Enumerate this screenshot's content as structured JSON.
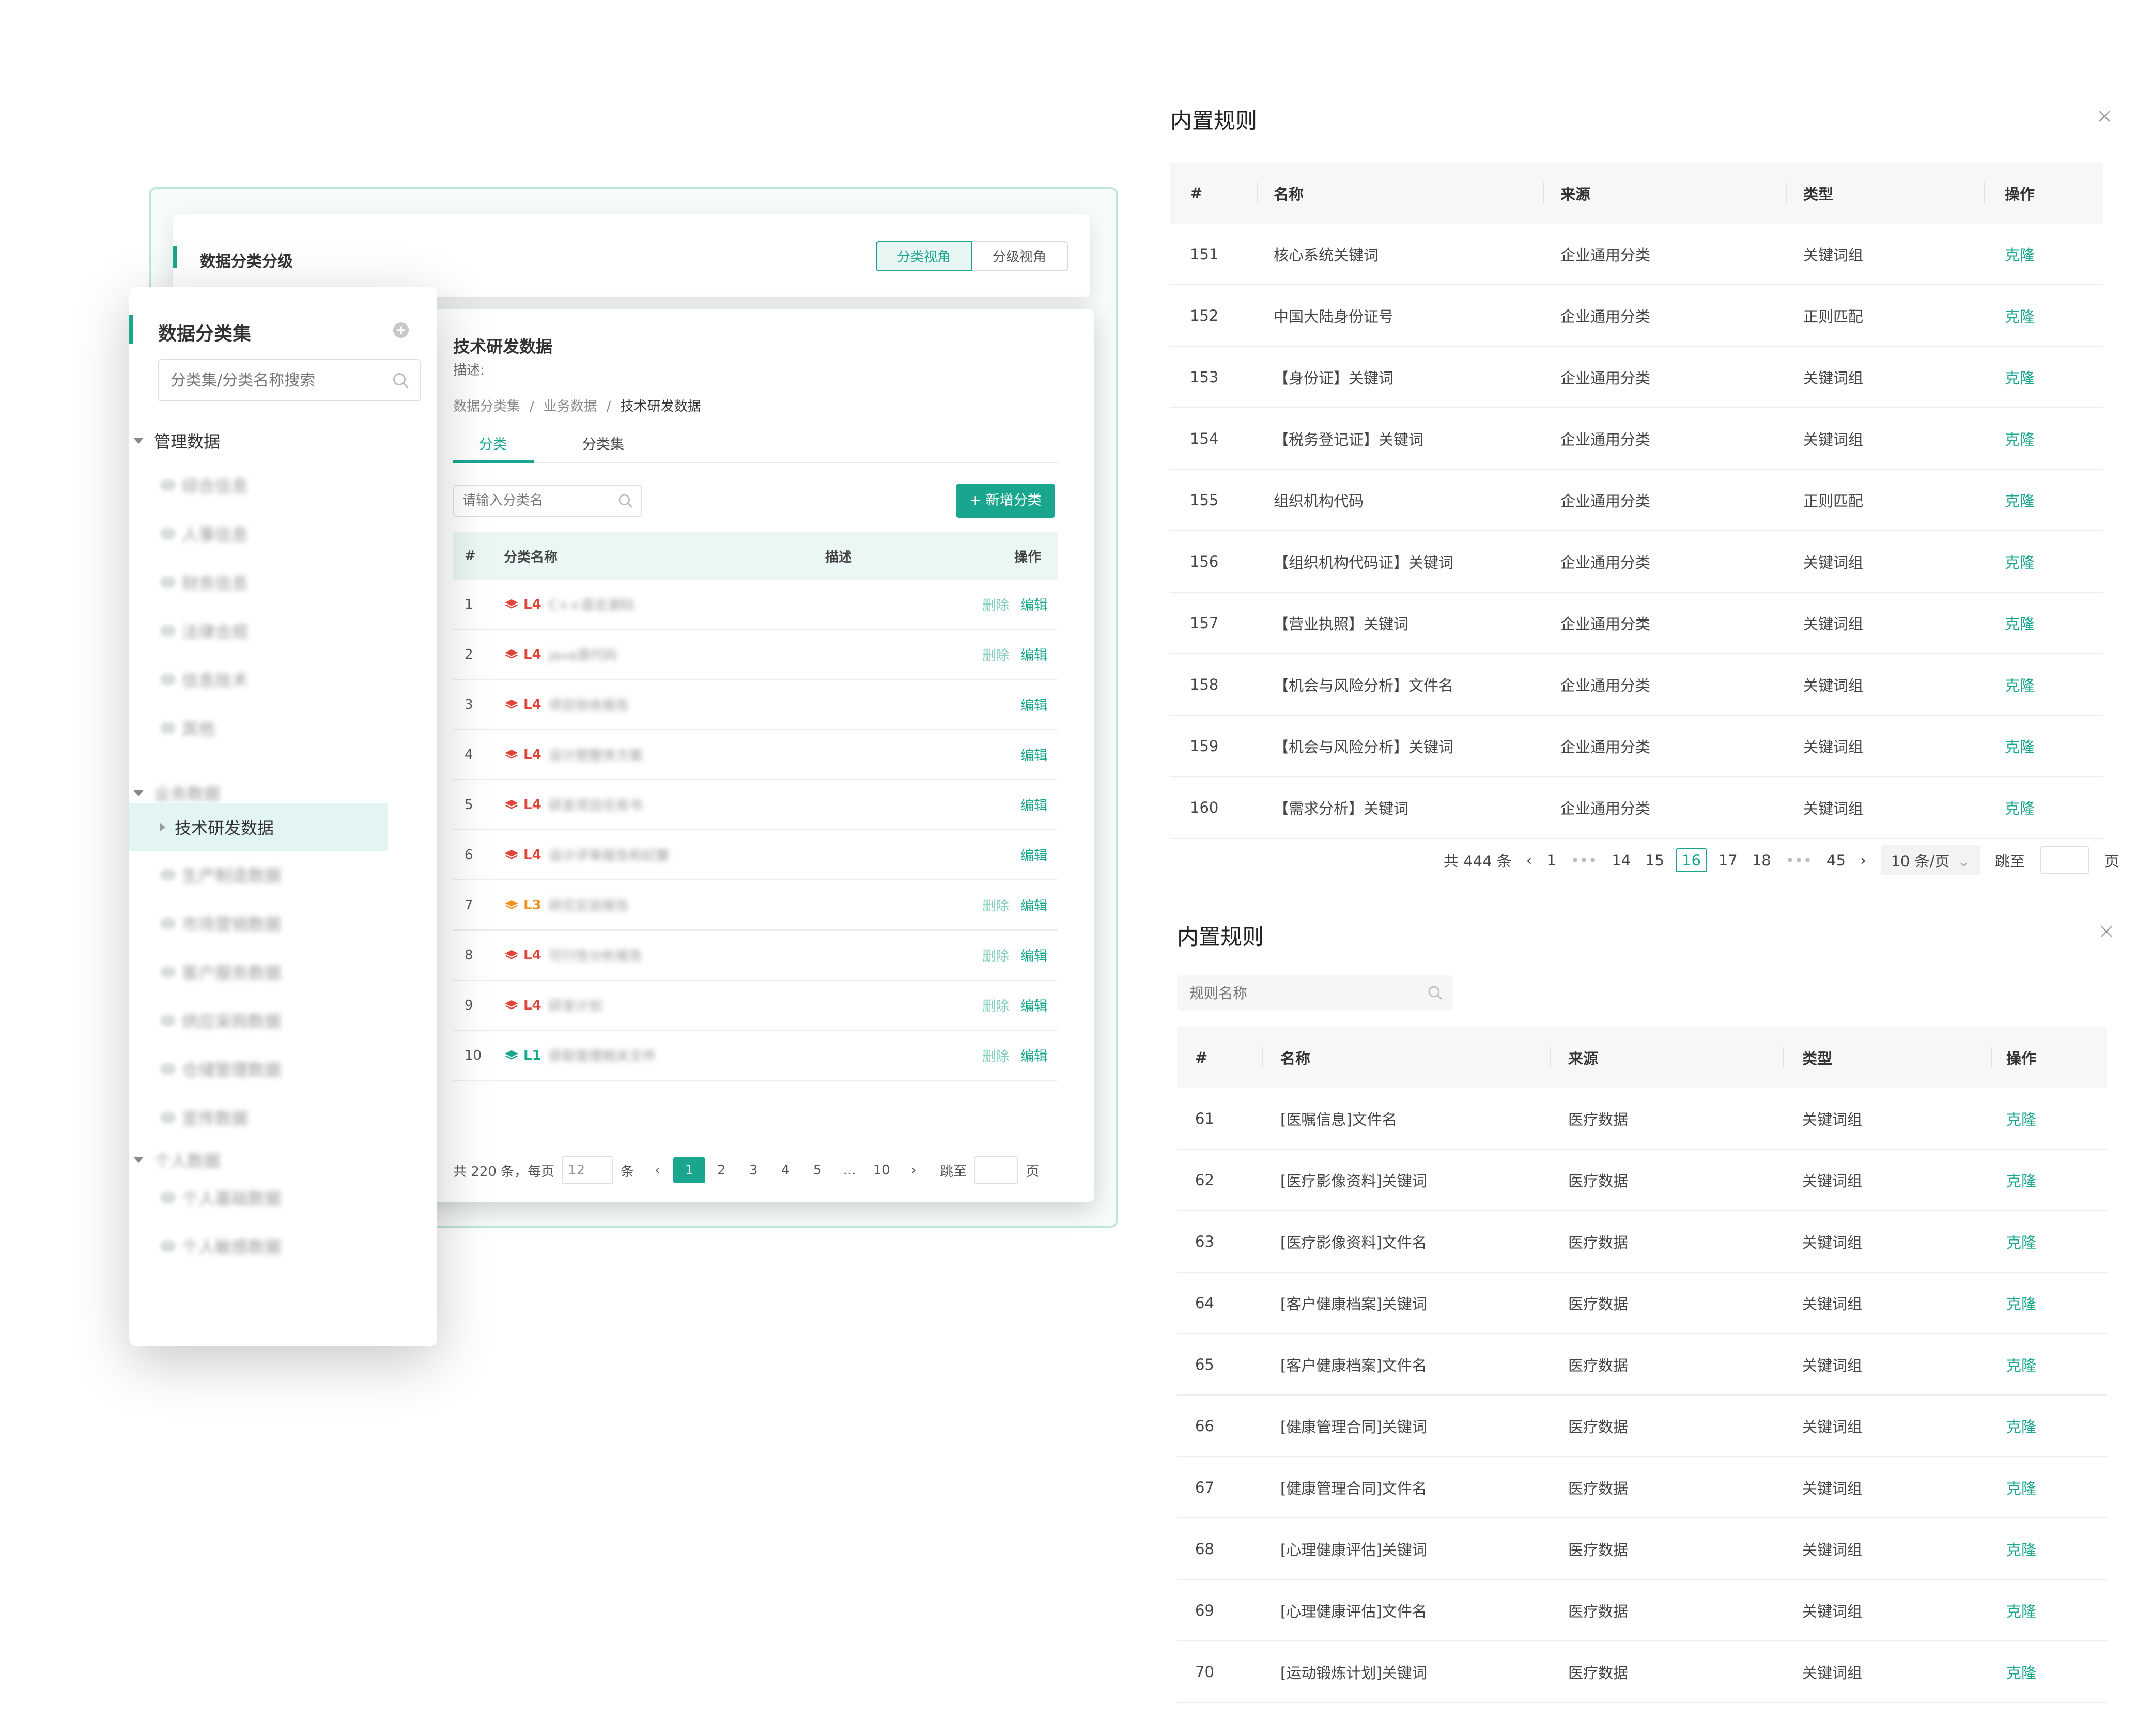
{
  "left": {
    "header": {
      "title": "数据分类分级",
      "tab_classify": "分类视角",
      "tab_grade": "分级视角"
    },
    "sidebar": {
      "title": "数据分类集",
      "search_placeholder": "分类集/分类名称搜索",
      "group1": "管理数据",
      "group1_items": [
        "综合信息",
        "人事信息",
        "财务信息",
        "法律合规",
        "信息技术",
        "其他"
      ],
      "group2": "业务数据",
      "selected_item": "技术研发数据",
      "group2_items": [
        "生产制造数据",
        "市场营销数据",
        "客户服务数据",
        "供应采购数据",
        "仓储管理数据",
        "宣传数据"
      ],
      "group3": "个人数据",
      "group3_items": [
        "个人基础数据",
        "个人敏感数据"
      ]
    },
    "main": {
      "title": "技术研发数据",
      "desc_label": "描述:",
      "breadcrumb": [
        "数据分类集",
        "业务数据",
        "技术研发数据"
      ],
      "tab_classes": "分类",
      "tab_sets": "分类集",
      "search_placeholder": "请输入分类名",
      "add_button": "+ 新增分类",
      "columns": [
        "#",
        "分类名称",
        "描述",
        "操作"
      ],
      "rows": [
        {
          "no": "1",
          "level": "L4",
          "level_color": "#e0453a",
          "name": "C++语言源码",
          "del": "删除",
          "edit": "编辑"
        },
        {
          "no": "2",
          "level": "L4",
          "level_color": "#e0453a",
          "name": "java源代码",
          "del": "删除",
          "edit": "编辑"
        },
        {
          "no": "3",
          "level": "L4",
          "level_color": "#e0453a",
          "name": "项目验收报告",
          "del": "",
          "edit": "编辑"
        },
        {
          "no": "4",
          "level": "L4",
          "level_color": "#e0453a",
          "name": "设计图整体方案",
          "del": "",
          "edit": "编辑"
        },
        {
          "no": "5",
          "level": "L4",
          "level_color": "#e0453a",
          "name": "研发项目任务书",
          "del": "",
          "edit": "编辑"
        },
        {
          "no": "6",
          "level": "L4",
          "level_color": "#e0453a",
          "name": "设计评审报告和纪要",
          "del": "",
          "edit": "编辑"
        },
        {
          "no": "7",
          "level": "L3",
          "level_color": "#f0921e",
          "name": "研究实验报告",
          "del": "删除",
          "edit": "编辑"
        },
        {
          "no": "8",
          "level": "L4",
          "level_color": "#e0453a",
          "name": "可行性分析报告",
          "del": "删除",
          "edit": "编辑"
        },
        {
          "no": "9",
          "level": "L4",
          "level_color": "#e0453a",
          "name": "研发计划",
          "del": "删除",
          "edit": "编辑"
        },
        {
          "no": "10",
          "level": "L1",
          "level_color": "#1aa68e",
          "name": "获取管理相关文件",
          "del": "删除",
          "edit": "编辑"
        }
      ],
      "pagination": {
        "total": "共 220 条，每页",
        "per_page": "12",
        "unit": "条",
        "pages": [
          "1",
          "2",
          "3",
          "4",
          "5",
          "...",
          "10"
        ],
        "active": "1",
        "jump": "跳至",
        "page_unit": "页"
      }
    }
  },
  "dialog1": {
    "title": "内置规则",
    "columns": [
      "#",
      "名称",
      "来源",
      "类型",
      "操作"
    ],
    "rows": [
      {
        "no": "151",
        "name": "核心系统关键词",
        "source": "企业通用分类",
        "type": "关键词组",
        "op": "克隆"
      },
      {
        "no": "152",
        "name": "中国大陆身份证号",
        "source": "企业通用分类",
        "type": "正则匹配",
        "op": "克隆"
      },
      {
        "no": "153",
        "name": "【身份证】关键词",
        "source": "企业通用分类",
        "type": "关键词组",
        "op": "克隆"
      },
      {
        "no": "154",
        "name": "【税务登记证】关键词",
        "source": "企业通用分类",
        "type": "关键词组",
        "op": "克隆"
      },
      {
        "no": "155",
        "name": "组织机构代码",
        "source": "企业通用分类",
        "type": "正则匹配",
        "op": "克隆"
      },
      {
        "no": "156",
        "name": "【组织机构代码证】关键词",
        "source": "企业通用分类",
        "type": "关键词组",
        "op": "克隆"
      },
      {
        "no": "157",
        "name": "【营业执照】关键词",
        "source": "企业通用分类",
        "type": "关键词组",
        "op": "克隆"
      },
      {
        "no": "158",
        "name": "【机会与风险分析】文件名",
        "source": "企业通用分类",
        "type": "关键词组",
        "op": "克隆"
      },
      {
        "no": "159",
        "name": "【机会与风险分析】关键词",
        "source": "企业通用分类",
        "type": "关键词组",
        "op": "克隆"
      },
      {
        "no": "160",
        "name": "【需求分析】关键词",
        "source": "企业通用分类",
        "type": "关键词组",
        "op": "克隆"
      }
    ],
    "pagination": {
      "total": "共 444 条",
      "pages": [
        "1",
        "•••",
        "14",
        "15",
        "16",
        "17",
        "18",
        "•••",
        "45"
      ],
      "active": "16",
      "page_size": "10 条/页",
      "jump": "跳至",
      "page_unit": "页"
    }
  },
  "dialog2": {
    "title": "内置规则",
    "search_placeholder": "规则名称",
    "columns": [
      "#",
      "名称",
      "来源",
      "类型",
      "操作"
    ],
    "rows": [
      {
        "no": "61",
        "name": "[医嘱信息]文件名",
        "source": "医疗数据",
        "type": "关键词组",
        "op": "克隆"
      },
      {
        "no": "62",
        "name": "[医疗影像资料]关键词",
        "source": "医疗数据",
        "type": "关键词组",
        "op": "克隆"
      },
      {
        "no": "63",
        "name": "[医疗影像资料]文件名",
        "source": "医疗数据",
        "type": "关键词组",
        "op": "克隆"
      },
      {
        "no": "64",
        "name": "[客户健康档案]关键词",
        "source": "医疗数据",
        "type": "关键词组",
        "op": "克隆"
      },
      {
        "no": "65",
        "name": "[客户健康档案]文件名",
        "source": "医疗数据",
        "type": "关键词组",
        "op": "克隆"
      },
      {
        "no": "66",
        "name": "[健康管理合同]关键词",
        "source": "医疗数据",
        "type": "关键词组",
        "op": "克隆"
      },
      {
        "no": "67",
        "name": "[健康管理合同]文件名",
        "source": "医疗数据",
        "type": "关键词组",
        "op": "克隆"
      },
      {
        "no": "68",
        "name": "[心理健康评估]关键词",
        "source": "医疗数据",
        "type": "关键词组",
        "op": "克隆"
      },
      {
        "no": "69",
        "name": "[心理健康评估]文件名",
        "source": "医疗数据",
        "type": "关键词组",
        "op": "克隆"
      },
      {
        "no": "70",
        "name": "[运动锻炼计划]关键词",
        "source": "医疗数据",
        "type": "关键词组",
        "op": "克隆"
      }
    ]
  },
  "colors": {
    "accent": "#1aa68e",
    "accent_light": "#e3f5f2",
    "danger": "#e0453a",
    "warning": "#f0921e"
  },
  "icons": [
    "search-icon",
    "plus-circle-icon",
    "close-icon",
    "caret-down-icon",
    "caret-right-icon",
    "layers-icon",
    "chevron-left-icon",
    "chevron-right-icon",
    "chevron-down-icon"
  ]
}
